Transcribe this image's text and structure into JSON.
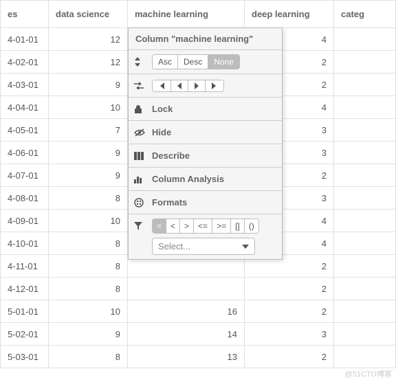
{
  "columns": {
    "c0": "es",
    "c1": "data science",
    "c2": "machine learning",
    "c3": "deep learning",
    "c4": "categ"
  },
  "rows": [
    {
      "d": "4-01-01",
      "ds": 12,
      "ml": "",
      "dl": 4
    },
    {
      "d": "4-02-01",
      "ds": 12,
      "ml": "",
      "dl": 2
    },
    {
      "d": "4-03-01",
      "ds": 9,
      "ml": "",
      "dl": 2
    },
    {
      "d": "4-04-01",
      "ds": 10,
      "ml": "",
      "dl": 4
    },
    {
      "d": "4-05-01",
      "ds": 7,
      "ml": "",
      "dl": 3
    },
    {
      "d": "4-06-01",
      "ds": 9,
      "ml": "",
      "dl": 3
    },
    {
      "d": "4-07-01",
      "ds": 9,
      "ml": "",
      "dl": 2
    },
    {
      "d": "4-08-01",
      "ds": 8,
      "ml": "",
      "dl": 3
    },
    {
      "d": "4-09-01",
      "ds": 10,
      "ml": "",
      "dl": 4
    },
    {
      "d": "4-10-01",
      "ds": 8,
      "ml": "",
      "dl": 4
    },
    {
      "d": "4-11-01",
      "ds": 8,
      "ml": "",
      "dl": 2
    },
    {
      "d": "4-12-01",
      "ds": 8,
      "ml": "",
      "dl": 2
    },
    {
      "d": "5-01-01",
      "ds": 10,
      "ml": 16,
      "dl": 2
    },
    {
      "d": "5-02-01",
      "ds": 9,
      "ml": 14,
      "dl": 3
    },
    {
      "d": "5-03-01",
      "ds": 8,
      "ml": 13,
      "dl": 2
    }
  ],
  "menu": {
    "title": "Column \"machine learning\"",
    "sort": {
      "asc": "Asc",
      "desc": "Desc",
      "none": "None"
    },
    "lock": "Lock",
    "hide": "Hide",
    "describe": "Describe",
    "analysis": "Column Analysis",
    "formats": "Formats",
    "ops": {
      "eq": "=",
      "lt": "<",
      "gt": ">",
      "le": "<=",
      "ge": ">=",
      "br": "[]",
      "pa": "()"
    },
    "select": "Select..."
  },
  "watermark": "@51CTO博客"
}
